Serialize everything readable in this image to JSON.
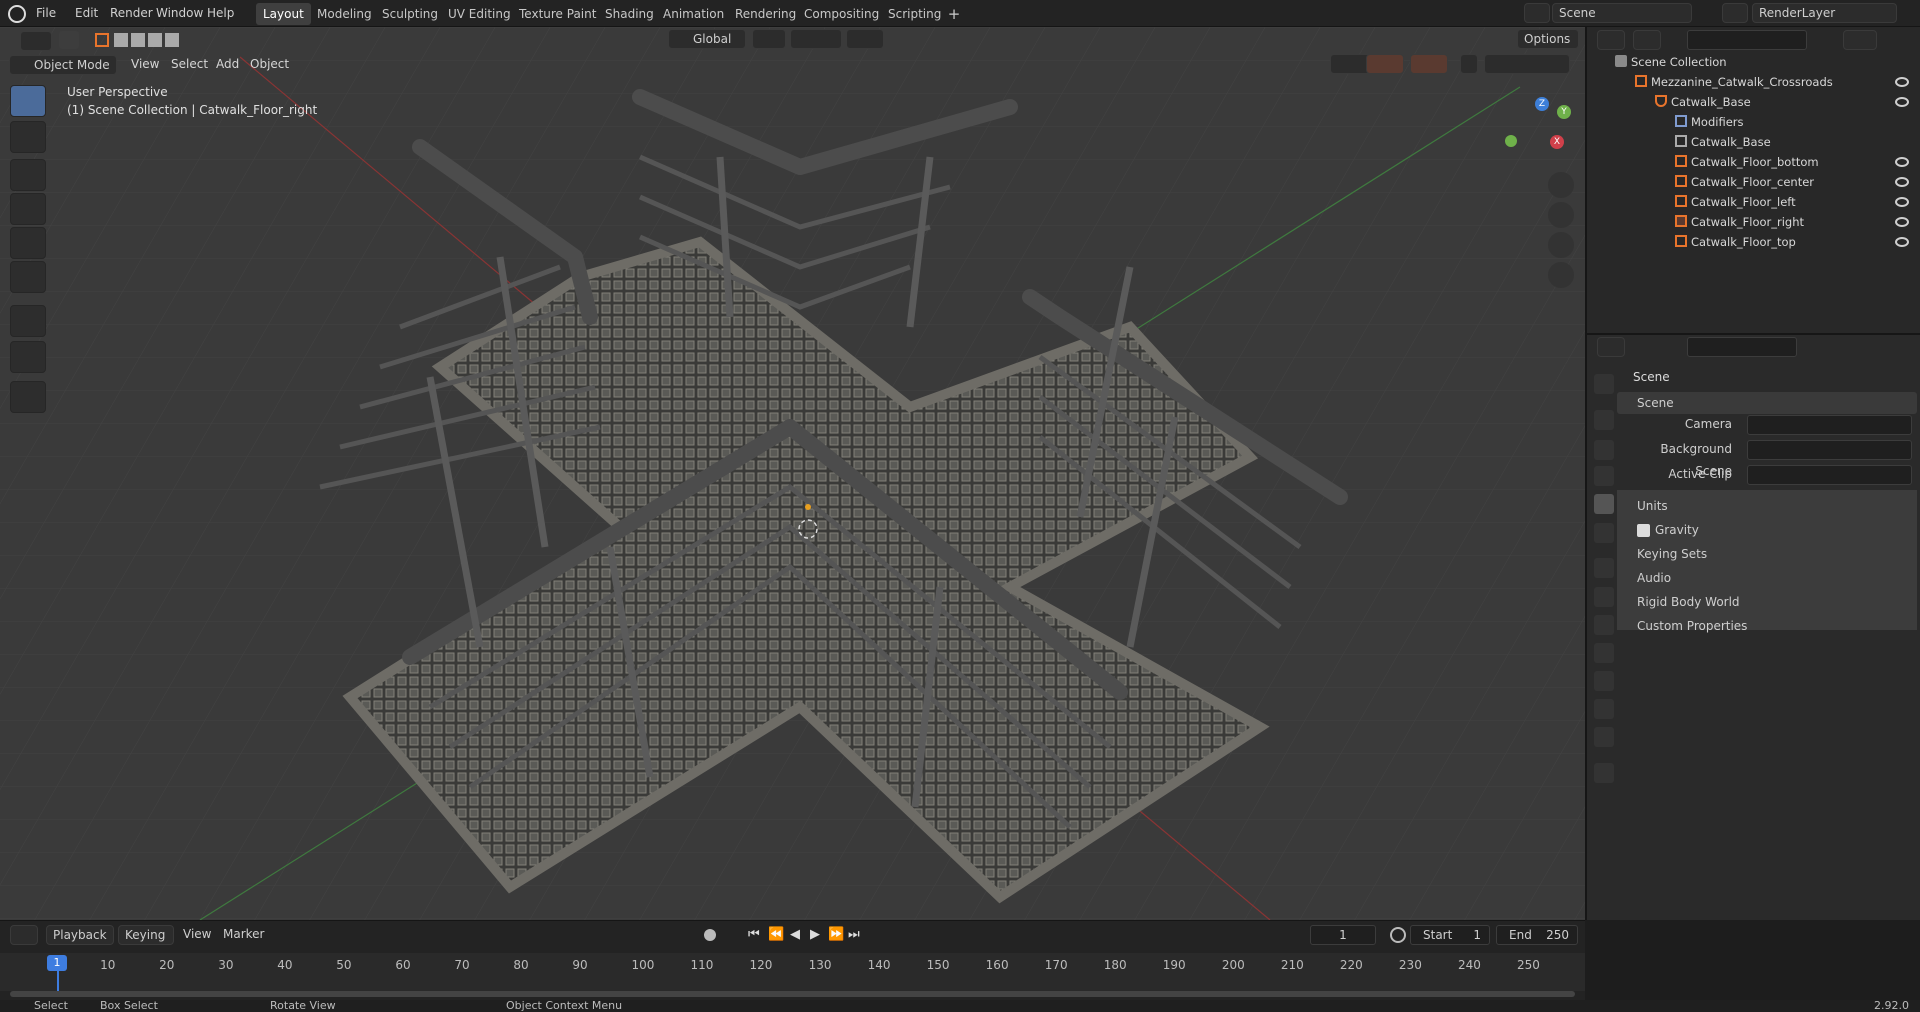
{
  "menubar": {
    "items": [
      "File",
      "Edit",
      "Render",
      "Window",
      "Help"
    ]
  },
  "workspaces": [
    "Layout",
    "Modeling",
    "Sculpting",
    "UV Editing",
    "Texture Paint",
    "Shading",
    "Animation",
    "Rendering",
    "Compositing",
    "Scripting"
  ],
  "active_workspace": "Layout",
  "scene_name": "Scene",
  "render_layer": "RenderLayer",
  "viewport": {
    "mode": "Object Mode",
    "menus": [
      "View",
      "Select",
      "Add",
      "Object"
    ],
    "transform": "Global",
    "options": "Options",
    "overlay_line1": "User Perspective",
    "overlay_line2": "(1) Scene Collection | Catwalk_Floor_right",
    "gizmo": {
      "x": "X",
      "y": "Y",
      "z": "Z"
    }
  },
  "outliner": {
    "root": "Scene Collection",
    "items": [
      {
        "name": "Mezzanine_Catwalk_Crossroads",
        "depth": 0
      },
      {
        "name": "Catwalk_Base",
        "depth": 1
      },
      {
        "name": "Modifiers",
        "depth": 2
      },
      {
        "name": "Catwalk_Base",
        "depth": 2
      },
      {
        "name": "Catwalk_Floor_bottom",
        "depth": 2
      },
      {
        "name": "Catwalk_Floor_center",
        "depth": 2
      },
      {
        "name": "Catwalk_Floor_left",
        "depth": 2
      },
      {
        "name": "Catwalk_Floor_right",
        "depth": 2
      },
      {
        "name": "Catwalk_Floor_top",
        "depth": 2
      }
    ]
  },
  "properties": {
    "header": "Scene",
    "panel": "Scene",
    "fields": {
      "camera": "Camera",
      "background_scene": "Background Scene",
      "active_clip": "Active Clip"
    },
    "subpanels": [
      "Units",
      "Gravity",
      "Keying Sets",
      "Audio",
      "Rigid Body World",
      "Custom Properties"
    ]
  },
  "timeline": {
    "menus": [
      "Playback",
      "Keying",
      "View",
      "Marker"
    ],
    "current_frame": "1",
    "start_label": "Start",
    "start": "1",
    "end_label": "End",
    "end": "250",
    "ticks": [
      "1",
      "10",
      "20",
      "30",
      "40",
      "50",
      "60",
      "70",
      "80",
      "90",
      "100",
      "110",
      "120",
      "130",
      "140",
      "150",
      "160",
      "170",
      "180",
      "190",
      "200",
      "210",
      "220",
      "230",
      "240",
      "250"
    ]
  },
  "status": {
    "select": "Select",
    "box_select": "Box Select",
    "rotate": "Rotate View",
    "context": "Object Context Menu",
    "version": "2.92.0"
  },
  "colors": {
    "accent": "#e8742c",
    "selected_row": "#334d80",
    "active_tool": "#4b6b9a"
  }
}
